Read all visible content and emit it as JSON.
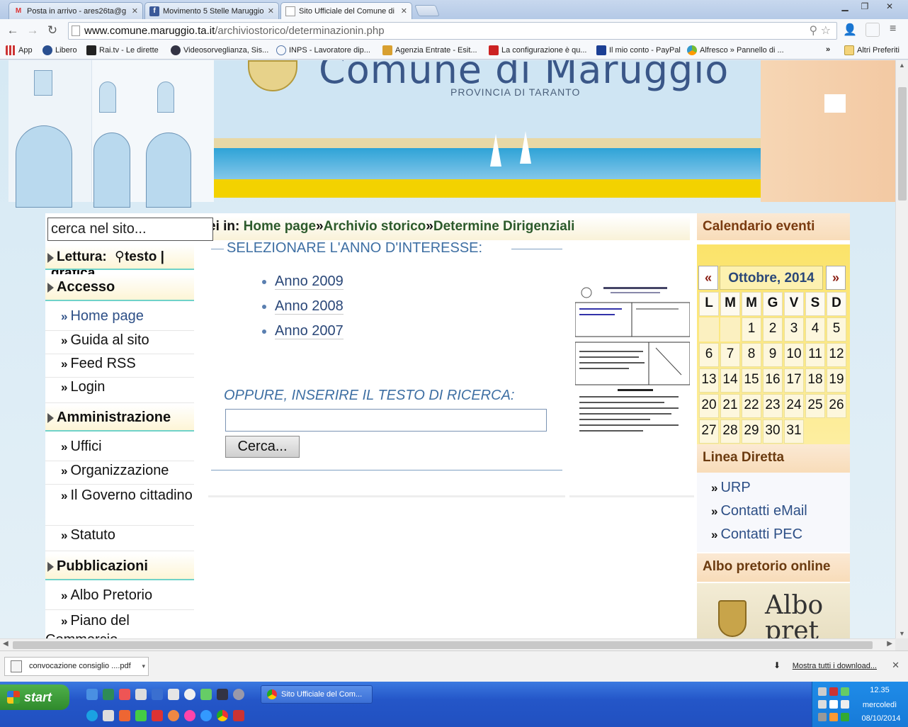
{
  "browser": {
    "tabs": [
      {
        "label": "Posta in arrivo - ares26ta@g",
        "icon": "gmail-icon"
      },
      {
        "label": "Movimento 5 Stelle Maruggio",
        "icon": "facebook-icon"
      },
      {
        "label": "Sito Ufficiale del Comune di M",
        "icon": "page-icon"
      }
    ],
    "url_host": "www.comune.maruggio.ta.it",
    "url_path": "/archiviostorico/determinazionin.php",
    "bookmarks": [
      {
        "label": "App"
      },
      {
        "label": "Libero"
      },
      {
        "label": "Rai.tv - Le dirette"
      },
      {
        "label": "Videosorveglianza, Sis..."
      },
      {
        "label": "INPS - Lavoratore dip..."
      },
      {
        "label": "Agenzia Entrate - Esit..."
      },
      {
        "label": "La configurazione è qu..."
      },
      {
        "label": "Il mio conto - PayPal"
      },
      {
        "label": "Alfresco » Pannello di ..."
      }
    ],
    "bookmarks_more": "»",
    "other_bookmarks": "Altri Preferiti"
  },
  "banner": {
    "title": "Comune di Maruggio",
    "subtitle": "PROVINCIA DI TARANTO"
  },
  "sidebar": {
    "search_placeholder": "cerca nel sito...",
    "reading_label": "Lettura:",
    "reading_text": "testo |",
    "reading_graphic": "grafica",
    "sections": [
      {
        "title": "Accesso",
        "items": [
          "Home page",
          "Guida al sito",
          "Feed RSS",
          "Login"
        ]
      },
      {
        "title": "Amministrazione",
        "items": [
          "Uffici",
          "Organizzazione",
          "Il Governo cittadino",
          "Statuto"
        ]
      },
      {
        "title": "Pubblicazioni",
        "items": [
          "Albo Pretorio",
          "Piano del Commercio"
        ]
      }
    ]
  },
  "main": {
    "breadcrumb_prefix": "ei in:",
    "breadcrumb": [
      "Home page",
      "Archivio storico",
      "Determine Dirigenziali"
    ],
    "breadcrumb_sep": "»",
    "select_legend": "SELEZIONARE L'ANNO D'INTERESSE:",
    "years": [
      "Anno 2009",
      "Anno 2008",
      "Anno 2007"
    ],
    "search_legend": "OPPURE, INSERIRE IL TESTO DI RICERCA:",
    "search_value": "",
    "search_button": "Cerca..."
  },
  "right": {
    "calendar_title": "Calendario eventi",
    "prev": "«",
    "next": "»",
    "month": "Ottobre, 2014",
    "weekdays": [
      "L",
      "M",
      "M",
      "G",
      "V",
      "S",
      "D"
    ],
    "leading_blanks": 2,
    "days_in_month": 31,
    "linea_title": "Linea Diretta",
    "linea_links": [
      "URP",
      "Contatti eMail",
      "Contatti PEC"
    ],
    "albo_title": "Albo pretorio online",
    "albo_img_text": "Albo pret"
  },
  "downloads": {
    "file": "convocazione consiglio ....pdf",
    "show_all": "Mostra tutti i download...",
    "close": "✕"
  },
  "taskbar": {
    "start": "start",
    "task": "Sito Ufficiale del Com...",
    "time": "12.35",
    "weekday": "mercoledì",
    "date": "08/10/2014"
  },
  "colors": {
    "accent": "#3e6fa3",
    "calendar_bg": "#fbe36a",
    "header_peach": "#f8dcb9",
    "taskbar": "#2456c8"
  }
}
